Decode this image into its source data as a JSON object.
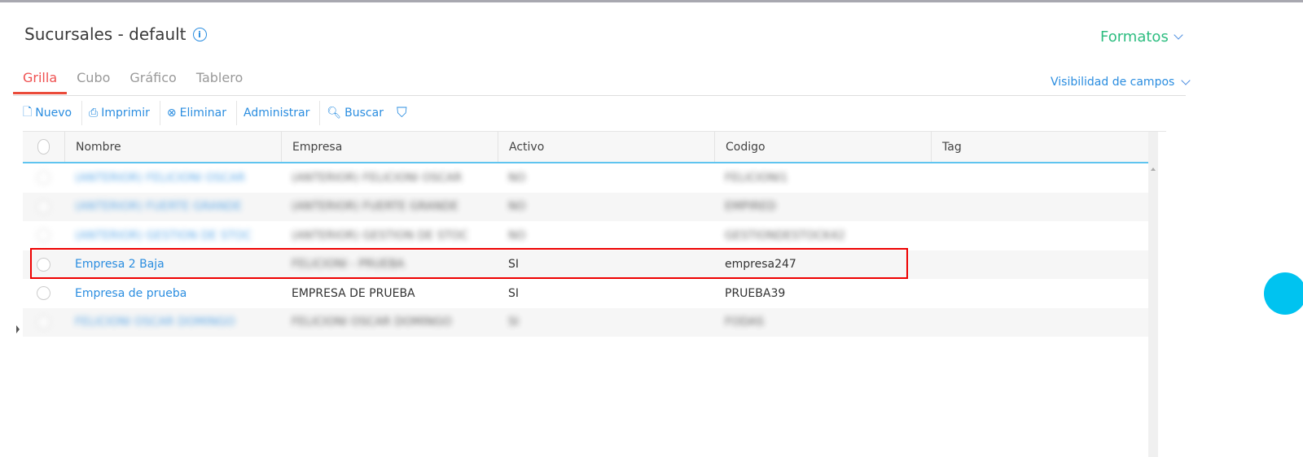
{
  "header": {
    "title": "Sucursales - default",
    "formatos": "Formatos",
    "visibilidad": "Visibilidad de campos"
  },
  "tabs": [
    {
      "label": "Grilla",
      "active": true
    },
    {
      "label": "Cubo"
    },
    {
      "label": "Gráfico"
    },
    {
      "label": "Tablero"
    }
  ],
  "toolbar": {
    "nuevo": "Nuevo",
    "imprimir": "Imprimir",
    "eliminar": "Eliminar",
    "administrar": "Administrar",
    "buscar": "Buscar"
  },
  "grid": {
    "columns": [
      "Nombre",
      "Empresa",
      "Activo",
      "Codigo",
      "Tag"
    ],
    "rows": [
      {
        "nombre": "(ANTERIOR) FELICIONI OSCAR",
        "empresa": "(ANTERIOR) FELICIONI OSCAR",
        "activo": "NO",
        "codigo": "FELICIONI1",
        "tag": "",
        "blurred": true
      },
      {
        "nombre": "(ANTERIOR) FUERTE GRANDE",
        "empresa": "(ANTERIOR) FUERTE GRANDE",
        "activo": "NO",
        "codigo": "EMPIRED",
        "tag": "",
        "blurred": true
      },
      {
        "nombre": "(ANTERIOR) GESTION DE STOC",
        "empresa": "(ANTERIOR) GESTION DE STOC",
        "activo": "NO",
        "codigo": "GESTIONDESTOCK42",
        "tag": "",
        "blurred": true
      },
      {
        "nombre": "Empresa 2 Baja",
        "empresa": "FELICIONI - PRUEBA",
        "activo": "SI",
        "codigo": "empresa247",
        "tag": "",
        "blurred_empresa": true,
        "highlighted": true
      },
      {
        "nombre": "Empresa de prueba",
        "empresa": "EMPRESA DE PRUEBA",
        "activo": "SI",
        "codigo": "PRUEBA39",
        "tag": ""
      },
      {
        "nombre": "FELICIONI OSCAR DOMINGO",
        "empresa": "FELICIONI OSCAR DOMINGO",
        "activo": "SI",
        "codigo": "FODAS",
        "tag": "",
        "blurred": true
      }
    ]
  },
  "colors": {
    "accent": "#2a8de0",
    "active_tab": "#ea4b3a",
    "formatos": "#2dbd80",
    "highlight": "#ee0000"
  }
}
